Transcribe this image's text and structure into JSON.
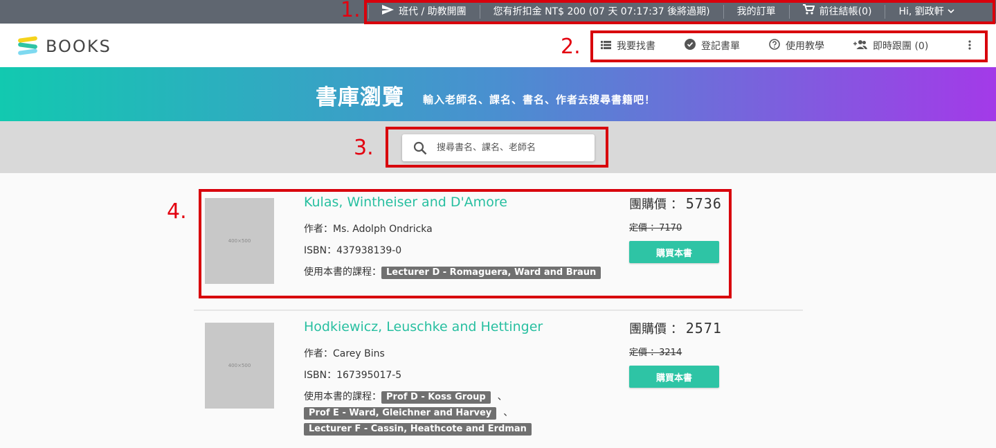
{
  "topbar": {
    "items": [
      {
        "label": "班代 / 助教開團",
        "icon": "send-icon"
      },
      {
        "label": "您有折扣金 NT$ 200 (07 天 07:17:37 後將過期)"
      },
      {
        "label": "我的訂單"
      },
      {
        "label": "前往結帳(0)",
        "icon": "cart-icon"
      },
      {
        "label": "Hi, 劉政軒",
        "icon": "chevron-down-icon"
      }
    ],
    "background": "#5f6670"
  },
  "header": {
    "logo_text": "BOOKS",
    "nav": [
      {
        "label": "我要找書",
        "icon": "list-icon"
      },
      {
        "label": "登記書單",
        "icon": "check-circle-icon"
      },
      {
        "label": "使用教學",
        "icon": "help-icon"
      },
      {
        "label": "即時跟團 (0)",
        "icon": "group-add-icon"
      }
    ],
    "more_icon": "more-vert-icon"
  },
  "hero": {
    "title": "書庫瀏覽",
    "subtitle": "輸入老師名、課名、書名、作者去搜尋書籍吧！",
    "gradient": [
      "#12c9b0",
      "#4a8fd0",
      "#a33ae8"
    ]
  },
  "search": {
    "placeholder": "搜尋書名、課名、老師名",
    "value": ""
  },
  "books": [
    {
      "cover_text": "400×500",
      "title": "Kulas, Wintheiser and D'Amore",
      "author_label": "作者：Ms. Adolph Ondricka",
      "isbn_label": "ISBN：437938139-0",
      "courses_label": "使用本書的課程：",
      "courses": [
        "Lecturer D - Romaguera, Ward and Braun"
      ],
      "group_price_label": "團購價 ：",
      "group_price": "5736",
      "list_price_label": "定價 ：7170",
      "buy_label": "購買本書"
    },
    {
      "cover_text": "400×500",
      "title": "Hodkiewicz, Leuschke and Hettinger",
      "author_label": "作者：Carey Bins",
      "isbn_label": "ISBN：167395017-5",
      "courses_label": "使用本書的課程：",
      "courses": [
        "Prof D - Koss Group",
        "Prof E - Ward, Gleichner and Harvey",
        "Lecturer F - Cassin, Heathcote and Erdman"
      ],
      "separator": "、",
      "group_price_label": "團購價 ：",
      "group_price": "2571",
      "list_price_label": "定價 ：3214",
      "buy_label": "購買本書"
    }
  ],
  "annotations": [
    "1.",
    "2.",
    "3.",
    "4."
  ],
  "colors": {
    "accent": "#2ec4a5",
    "title_link": "#27bfa0",
    "annotation": "#d8000c",
    "tag": "#707070"
  }
}
